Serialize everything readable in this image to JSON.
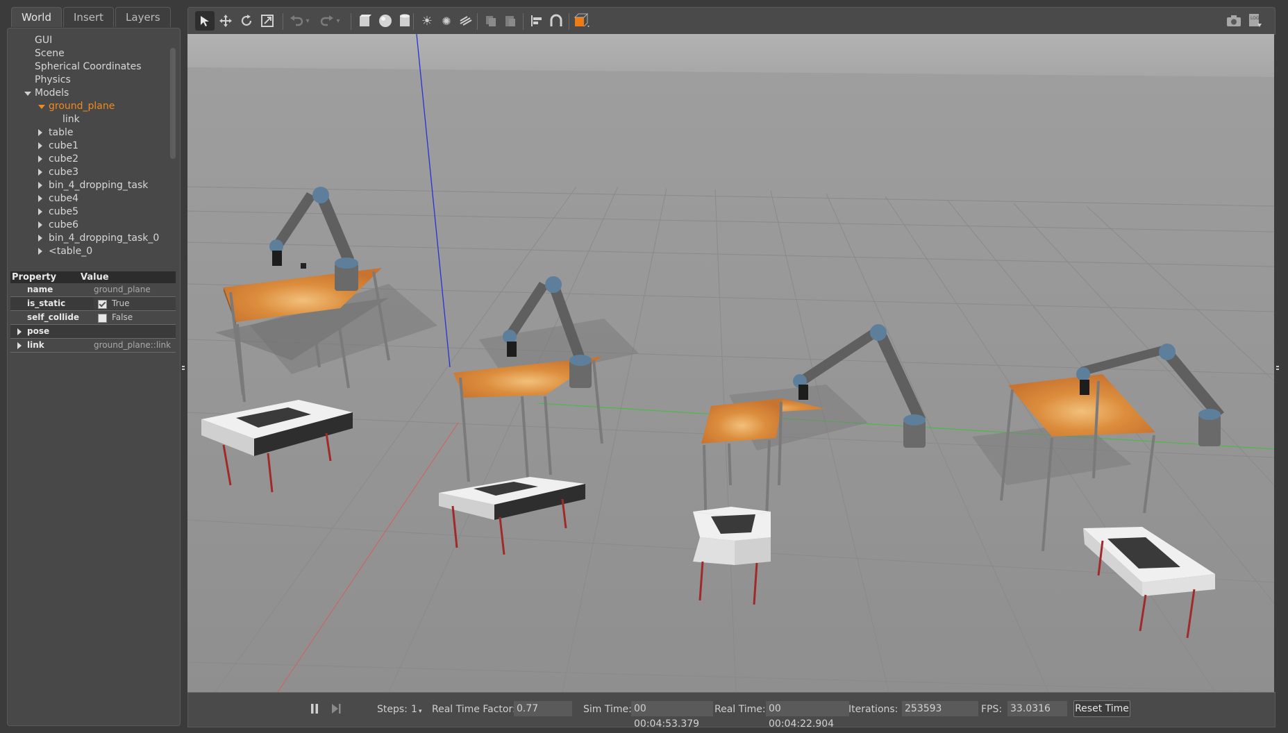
{
  "tabs": [
    "World",
    "Insert",
    "Layers"
  ],
  "tree": {
    "items": [
      {
        "label": "GUI",
        "indent": 0,
        "expander": "none",
        "selected": false
      },
      {
        "label": "Scene",
        "indent": 0,
        "expander": "none",
        "selected": false
      },
      {
        "label": "Spherical Coordinates",
        "indent": 0,
        "expander": "none",
        "selected": false
      },
      {
        "label": "Physics",
        "indent": 0,
        "expander": "none",
        "selected": false
      },
      {
        "label": "Models",
        "indent": 0,
        "expander": "down",
        "selected": false
      },
      {
        "label": "ground_plane",
        "indent": 1,
        "expander": "down",
        "selected": true
      },
      {
        "label": "link",
        "indent": 2,
        "expander": "none",
        "selected": false
      },
      {
        "label": "table",
        "indent": 1,
        "expander": "right",
        "selected": false
      },
      {
        "label": "cube1",
        "indent": 1,
        "expander": "right",
        "selected": false
      },
      {
        "label": "cube2",
        "indent": 1,
        "expander": "right",
        "selected": false
      },
      {
        "label": "cube3",
        "indent": 1,
        "expander": "right",
        "selected": false
      },
      {
        "label": "bin_4_dropping_task",
        "indent": 1,
        "expander": "right",
        "selected": false
      },
      {
        "label": "cube4",
        "indent": 1,
        "expander": "right",
        "selected": false
      },
      {
        "label": "cube5",
        "indent": 1,
        "expander": "right",
        "selected": false
      },
      {
        "label": "cube6",
        "indent": 1,
        "expander": "right",
        "selected": false
      },
      {
        "label": "bin_4_dropping_task_0",
        "indent": 1,
        "expander": "right",
        "selected": false
      },
      {
        "label": "<table_0",
        "indent": 1,
        "expander": "right",
        "selected": false
      }
    ]
  },
  "properties": {
    "header_property": "Property",
    "header_value": "Value",
    "name_key": "name",
    "name_value": "ground_plane",
    "is_static_key": "is_static",
    "is_static_value": "True",
    "self_collide_key": "self_collide",
    "self_collide_value": "False",
    "pose_key": "pose",
    "link_key": "link",
    "link_value": "ground_plane::link"
  },
  "toolbar": {
    "icons": [
      "select-arrow-icon",
      "translate-icon",
      "rotate-icon",
      "scale-icon",
      "undo-icon",
      "undo-dropdown-icon",
      "redo-icon",
      "redo-dropdown-icon",
      "box-icon",
      "sphere-icon",
      "cylinder-icon",
      "point-light-icon",
      "spot-light-icon",
      "directional-light-icon",
      "copy-icon",
      "paste-icon",
      "align-icon",
      "snap-icon",
      "change-view-icon",
      "screenshot-icon",
      "log-icon"
    ]
  },
  "bottom": {
    "steps_label": "Steps:",
    "steps_value": "1",
    "rtf_label": "Real Time Factor:",
    "rtf_value": "0.77",
    "sim_time_label": "Sim Time:",
    "sim_time_value": "00 00:04:53.379",
    "real_time_label": "Real Time:",
    "real_time_value": "00 00:04:22.904",
    "iterations_label": "Iterations:",
    "iterations_value": "253593",
    "fps_label": "FPS:",
    "fps_value": "33.0316",
    "reset_label": "Reset Time"
  },
  "colors": {
    "selected_text": "#f28a1c",
    "panel_bg": "#484848",
    "viewport_bg": "#9b9b9b",
    "table_top": "#d98a3a",
    "bin": "#dedede",
    "robot": "#6f6f6f",
    "robot_joint": "#5d7f9c"
  }
}
